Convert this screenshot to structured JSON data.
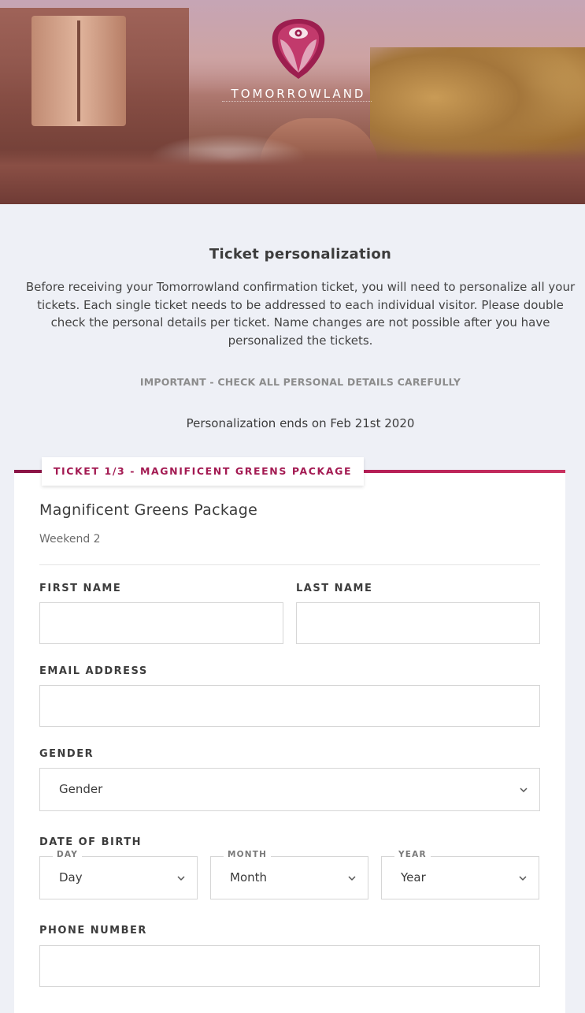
{
  "hero": {
    "brand": "TOMORROWLAND"
  },
  "intro": {
    "title": "Ticket personalization",
    "text": "Before receiving your Tomorrowland confirmation ticket, you will need to personalize all your tickets. Each single ticket needs to be addressed to each individual visitor. Please double check the personal details per ticket. Name changes are not possible after you have personalized the tickets.",
    "important": "IMPORTANT - CHECK ALL PERSONAL DETAILS CAREFULLY",
    "ends": "Personalization ends on Feb 21st 2020"
  },
  "ticket": {
    "tab_label": "TICKET 1/3 - MAGNIFICENT GREENS PACKAGE",
    "package_name": "Magnificent Greens Package",
    "weekend": "Weekend 2"
  },
  "form": {
    "first_name_label": "FIRST NAME",
    "first_name_value": "",
    "last_name_label": "LAST NAME",
    "last_name_value": "",
    "email_label": "EMAIL ADDRESS",
    "email_value": "",
    "gender_label": "GENDER",
    "gender_selected": "Gender",
    "dob_label": "DATE OF BIRTH",
    "day_label": "DAY",
    "day_selected": "Day",
    "month_label": "MONTH",
    "month_selected": "Month",
    "year_label": "YEAR",
    "year_selected": "Year",
    "phone_label": "PHONE NUMBER",
    "phone_value": ""
  },
  "colors": {
    "accent": "#a31a52",
    "page_bg": "#eef0f6"
  }
}
